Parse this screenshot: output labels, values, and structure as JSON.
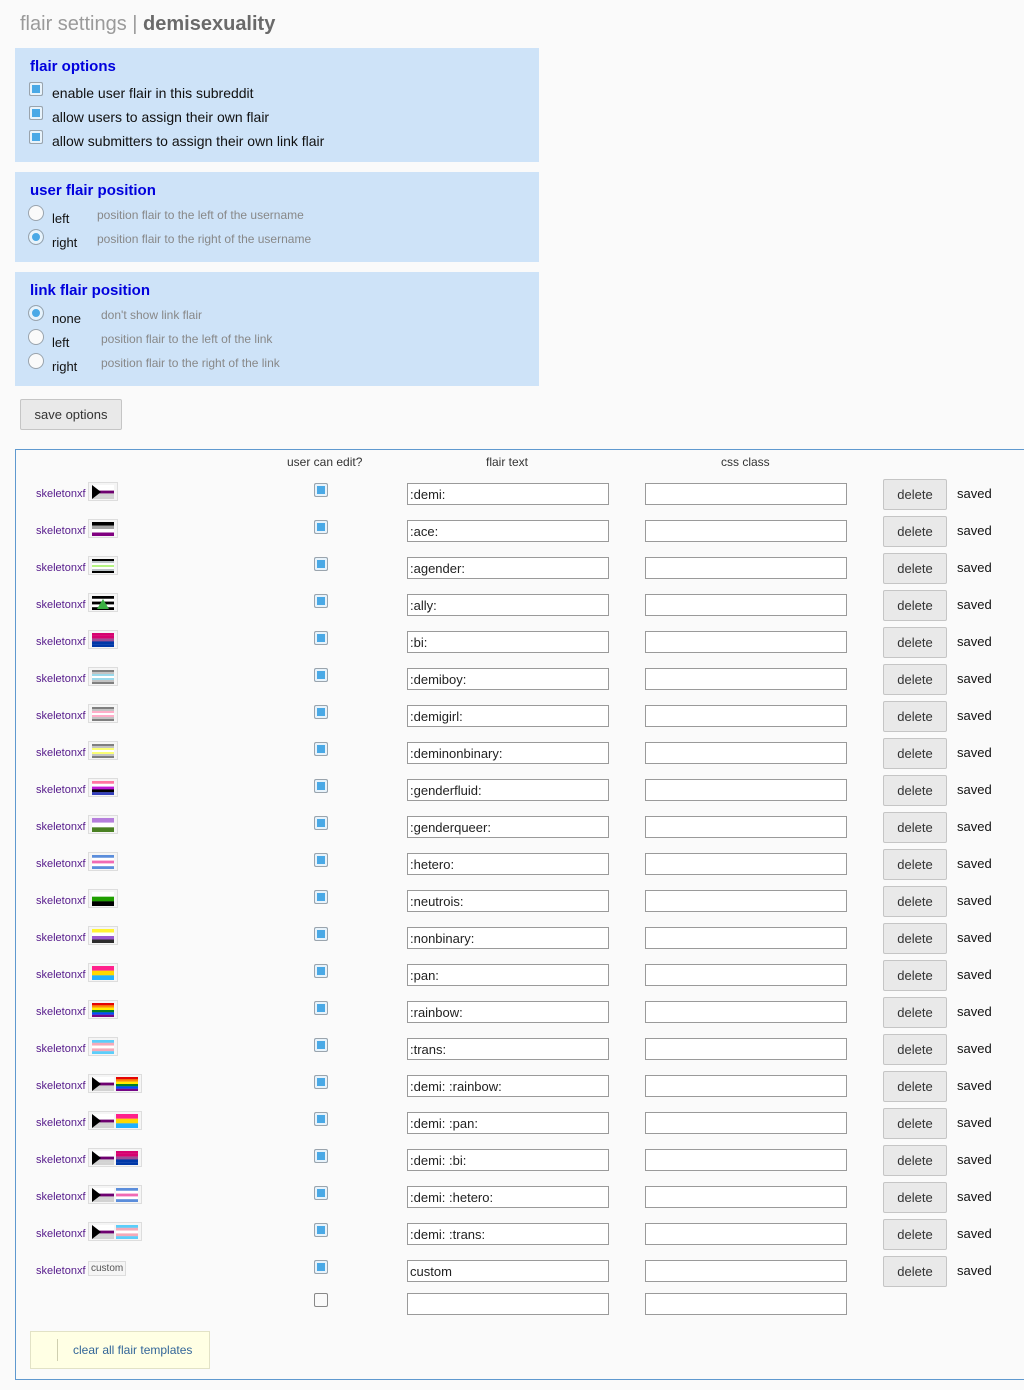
{
  "page": {
    "title_prefix": "flair settings",
    "separator": "|",
    "subreddit": "demisexuality"
  },
  "flair_options": {
    "heading": "flair options",
    "options": [
      {
        "label": "enable user flair in this subreddit",
        "checked": true
      },
      {
        "label": "allow users to assign their own flair",
        "checked": true
      },
      {
        "label": "allow submitters to assign their own link flair",
        "checked": true
      }
    ]
  },
  "user_flair_position": {
    "heading": "user flair position",
    "options": [
      {
        "label": "left",
        "hint": "position flair to the left of the username",
        "selected": false
      },
      {
        "label": "right",
        "hint": "position flair to the right of the username",
        "selected": true
      }
    ]
  },
  "link_flair_position": {
    "heading": "link flair position",
    "options": [
      {
        "label": "none",
        "hint": "don't show link flair",
        "selected": true
      },
      {
        "label": "left",
        "hint": "position flair to the left of the link",
        "selected": false
      },
      {
        "label": "right",
        "hint": "position flair to the right of the link",
        "selected": false
      }
    ]
  },
  "save_button": "save options",
  "table": {
    "headers": {
      "user_can_edit": "user can edit?",
      "flair_text": "flair text",
      "css_class": "css class"
    },
    "delete_label": "delete",
    "rows": [
      {
        "user": "skeletonxf",
        "flags": [
          "demi"
        ],
        "user_can_edit": true,
        "flair_text": ":demi:",
        "css_class": "",
        "status": "saved"
      },
      {
        "user": "skeletonxf",
        "flags": [
          "ace"
        ],
        "user_can_edit": true,
        "flair_text": ":ace:",
        "css_class": "",
        "status": "saved"
      },
      {
        "user": "skeletonxf",
        "flags": [
          "agender"
        ],
        "user_can_edit": true,
        "flair_text": ":agender:",
        "css_class": "",
        "status": "saved"
      },
      {
        "user": "skeletonxf",
        "flags": [
          "ally"
        ],
        "user_can_edit": true,
        "flair_text": ":ally:",
        "css_class": "",
        "status": "saved"
      },
      {
        "user": "skeletonxf",
        "flags": [
          "bi"
        ],
        "user_can_edit": true,
        "flair_text": ":bi:",
        "css_class": "",
        "status": "saved"
      },
      {
        "user": "skeletonxf",
        "flags": [
          "demiboy"
        ],
        "user_can_edit": true,
        "flair_text": ":demiboy:",
        "css_class": "",
        "status": "saved"
      },
      {
        "user": "skeletonxf",
        "flags": [
          "demigirl"
        ],
        "user_can_edit": true,
        "flair_text": ":demigirl:",
        "css_class": "",
        "status": "saved"
      },
      {
        "user": "skeletonxf",
        "flags": [
          "deminonbinary"
        ],
        "user_can_edit": true,
        "flair_text": ":deminonbinary:",
        "css_class": "",
        "status": "saved"
      },
      {
        "user": "skeletonxf",
        "flags": [
          "genderfluid"
        ],
        "user_can_edit": true,
        "flair_text": ":genderfluid:",
        "css_class": "",
        "status": "saved"
      },
      {
        "user": "skeletonxf",
        "flags": [
          "genderqueer"
        ],
        "user_can_edit": true,
        "flair_text": ":genderqueer:",
        "css_class": "",
        "status": "saved"
      },
      {
        "user": "skeletonxf",
        "flags": [
          "hetero"
        ],
        "user_can_edit": true,
        "flair_text": ":hetero:",
        "css_class": "",
        "status": "saved"
      },
      {
        "user": "skeletonxf",
        "flags": [
          "neutrois"
        ],
        "user_can_edit": true,
        "flair_text": ":neutrois:",
        "css_class": "",
        "status": "saved"
      },
      {
        "user": "skeletonxf",
        "flags": [
          "nonbinary"
        ],
        "user_can_edit": true,
        "flair_text": ":nonbinary:",
        "css_class": "",
        "status": "saved"
      },
      {
        "user": "skeletonxf",
        "flags": [
          "pan"
        ],
        "user_can_edit": true,
        "flair_text": ":pan:",
        "css_class": "",
        "status": "saved"
      },
      {
        "user": "skeletonxf",
        "flags": [
          "rainbow"
        ],
        "user_can_edit": true,
        "flair_text": ":rainbow:",
        "css_class": "",
        "status": "saved"
      },
      {
        "user": "skeletonxf",
        "flags": [
          "trans"
        ],
        "user_can_edit": true,
        "flair_text": ":trans:",
        "css_class": "",
        "status": "saved"
      },
      {
        "user": "skeletonxf",
        "flags": [
          "demi",
          "rainbow"
        ],
        "user_can_edit": true,
        "flair_text": ":demi: :rainbow:",
        "css_class": "",
        "status": "saved"
      },
      {
        "user": "skeletonxf",
        "flags": [
          "demi",
          "pan"
        ],
        "user_can_edit": true,
        "flair_text": ":demi: :pan:",
        "css_class": "",
        "status": "saved"
      },
      {
        "user": "skeletonxf",
        "flags": [
          "demi",
          "bi"
        ],
        "user_can_edit": true,
        "flair_text": ":demi: :bi:",
        "css_class": "",
        "status": "saved"
      },
      {
        "user": "skeletonxf",
        "flags": [
          "demi",
          "hetero"
        ],
        "user_can_edit": true,
        "flair_text": ":demi: :hetero:",
        "css_class": "",
        "status": "saved"
      },
      {
        "user": "skeletonxf",
        "flags": [
          "demi",
          "trans"
        ],
        "user_can_edit": true,
        "flair_text": ":demi: :trans:",
        "css_class": "",
        "status": "saved"
      },
      {
        "user": "skeletonxf",
        "flags": [],
        "flair_badge": "custom",
        "user_can_edit": true,
        "flair_text": "custom",
        "css_class": "",
        "status": "saved"
      }
    ],
    "new_row": {
      "user_can_edit": false,
      "flair_text": "",
      "css_class": ""
    }
  },
  "clear_all": "clear all flair templates",
  "flag_colors": {
    "demi": {
      "stripes": [
        "#ffffff",
        "#ffffff",
        "#6e0070",
        "#d2d2d2",
        "#d2d2d2"
      ],
      "chevron": "#000000"
    },
    "ace": {
      "stripes": [
        "#000000",
        "#a3a3a3",
        "#ffffff",
        "#800080"
      ]
    },
    "agender": {
      "stripes": [
        "#000000",
        "#bcc4c6",
        "#ffffff",
        "#b5f582",
        "#ffffff",
        "#bcc4c6",
        "#000000"
      ]
    },
    "ally": {
      "stripes": [
        "#000000",
        "#ffffff",
        "#000000",
        "#ffffff",
        "#000000"
      ],
      "overlay": "#3bb143"
    },
    "bi": {
      "stripes": [
        "#d60270",
        "#d60270",
        "#9b4f96",
        "#0038a8",
        "#0038a8"
      ]
    },
    "demiboy": {
      "stripes": [
        "#7f7f7f",
        "#c3c3c3",
        "#9ad9eb",
        "#ffffff",
        "#9ad9eb",
        "#c3c3c3",
        "#7f7f7f"
      ]
    },
    "demigirl": {
      "stripes": [
        "#7f7f7f",
        "#c3c3c3",
        "#ffaec9",
        "#ffffff",
        "#ffaec9",
        "#c3c3c3",
        "#7f7f7f"
      ]
    },
    "deminonbinary": {
      "stripes": [
        "#7f7f7f",
        "#c3c3c3",
        "#fbff75",
        "#ffffff",
        "#fbff75",
        "#c3c3c3",
        "#7f7f7f"
      ]
    },
    "genderfluid": {
      "stripes": [
        "#ff75a2",
        "#ffffff",
        "#be18d6",
        "#000000",
        "#333ebd"
      ]
    },
    "genderqueer": {
      "stripes": [
        "#b57edc",
        "#ffffff",
        "#4a8123"
      ]
    },
    "hetero": {
      "stripes": [
        "#5b8ddb",
        "#ffffff",
        "#f06ab4",
        "#ffffff",
        "#5b8ddb"
      ]
    },
    "neutrois": {
      "stripes": [
        "#ffffff",
        "#1f9f00",
        "#000000"
      ]
    },
    "nonbinary": {
      "stripes": [
        "#fff433",
        "#ffffff",
        "#9b59d0",
        "#2d2d2d"
      ]
    },
    "pan": {
      "stripes": [
        "#ff218c",
        "#ffd800",
        "#21b1ff"
      ]
    },
    "rainbow": {
      "stripes": [
        "#e40303",
        "#ff8c00",
        "#ffed00",
        "#008026",
        "#004dff",
        "#750787"
      ]
    },
    "trans": {
      "stripes": [
        "#5bcefa",
        "#f5a9b8",
        "#ffffff",
        "#f5a9b8",
        "#5bcefa"
      ]
    }
  }
}
